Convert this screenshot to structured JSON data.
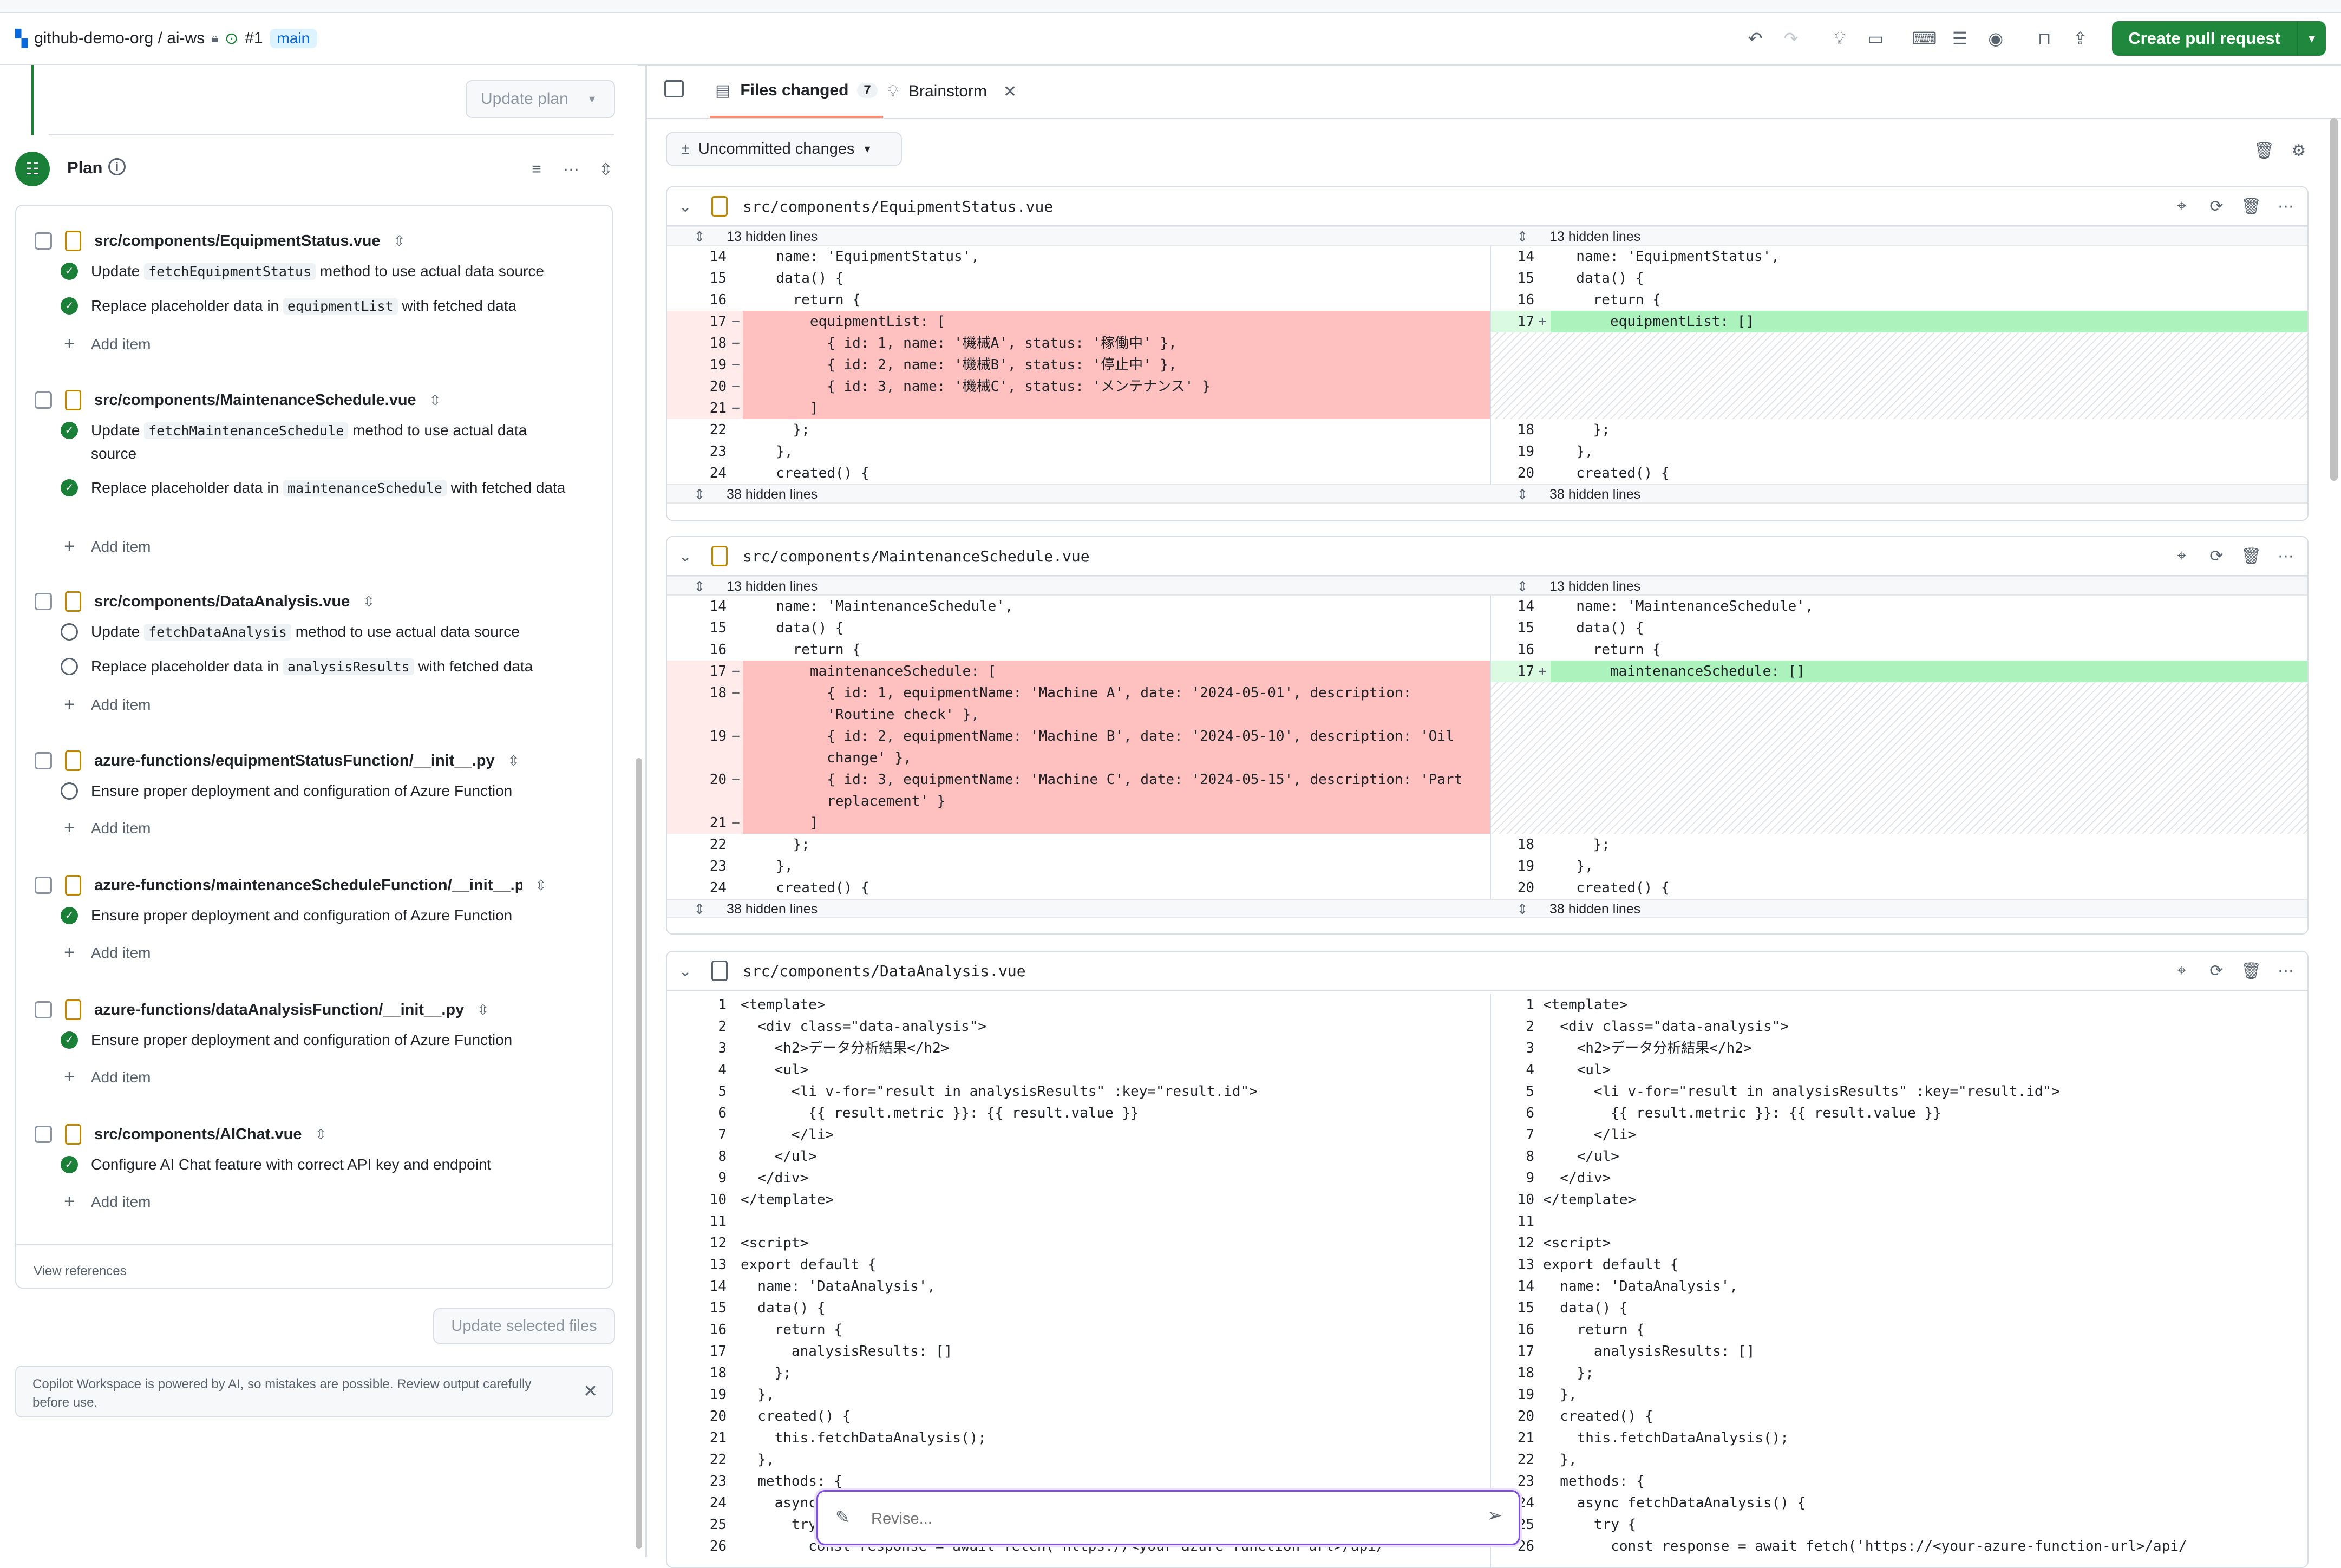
{
  "header": {
    "repo": "github-demo-org / ai-ws",
    "issue": "#1",
    "branch": "main",
    "create_pr": "Create pull request"
  },
  "plan": {
    "update_plan": "Update plan",
    "title": "Plan",
    "groups": [
      {
        "file": "src/components/EquipmentStatus.vue",
        "tasks": [
          {
            "status": "done",
            "pre": "Update ",
            "code": "fetchEquipmentStatus",
            "post": " method to use actual data source"
          },
          {
            "status": "done",
            "pre": "Replace placeholder data in ",
            "code": "equipmentList",
            "post": " with fetched data"
          }
        ]
      },
      {
        "file": "src/components/MaintenanceSchedule.vue",
        "tasks": [
          {
            "status": "done",
            "pre": "Update ",
            "code": "fetchMaintenanceSchedule",
            "post": " method to use actual data source"
          },
          {
            "status": "done",
            "pre": "Replace placeholder data in ",
            "code": "maintenanceSchedule",
            "post": " with fetched data"
          }
        ]
      },
      {
        "file": "src/components/DataAnalysis.vue",
        "tasks": [
          {
            "status": "open",
            "pre": "Update ",
            "code": "fetchDataAnalysis",
            "post": " method to use actual data source"
          },
          {
            "status": "open",
            "pre": "Replace placeholder data in ",
            "code": "analysisResults",
            "post": " with fetched data"
          }
        ]
      },
      {
        "file": "azure-functions/equipmentStatusFunction/__init__.py",
        "tasks": [
          {
            "status": "open",
            "pre": "Ensure proper deployment and configuration of Azure Function",
            "code": "",
            "post": ""
          }
        ]
      },
      {
        "file": "azure-functions/maintenanceScheduleFunction/__init__.py",
        "tasks": [
          {
            "status": "done",
            "pre": "Ensure proper deployment and configuration of Azure Function",
            "code": "",
            "post": ""
          }
        ]
      },
      {
        "file": "azure-functions/dataAnalysisFunction/__init__.py",
        "tasks": [
          {
            "status": "done",
            "pre": "Ensure proper deployment and configuration of Azure Function",
            "code": "",
            "post": ""
          }
        ]
      },
      {
        "file": "src/components/AIChat.vue",
        "tasks": [
          {
            "status": "done",
            "pre": "Configure AI Chat feature with correct API key and endpoint",
            "code": "",
            "post": ""
          }
        ]
      }
    ],
    "add_item": "Add item",
    "view_references": "View references",
    "update_selected": "Update selected files",
    "disclaimer": "Copilot Workspace is powered by AI, so mistakes are possible. Review output carefully before use."
  },
  "tabs": {
    "files_changed": "Files changed",
    "files_count": "7",
    "brainstorm": "Brainstorm"
  },
  "uncommitted": "Uncommitted changes",
  "diffs": [
    {
      "path": "src/components/EquipmentStatus.vue",
      "hidden_top": "13 hidden lines",
      "hidden_bottom": "38 hidden lines",
      "left": [
        {
          "n": "14",
          "m": "",
          "t": "  name: 'EquipmentStatus',"
        },
        {
          "n": "15",
          "m": "",
          "t": "  data() {"
        },
        {
          "n": "16",
          "m": "",
          "t": "    return {"
        },
        {
          "n": "17",
          "m": "−",
          "t": "      equipmentList: ["
        },
        {
          "n": "18",
          "m": "−",
          "t": "        { id: 1, name: '機械A', status: '稼働中' },"
        },
        {
          "n": "19",
          "m": "−",
          "t": "        { id: 2, name: '機械B', status: '停止中' },"
        },
        {
          "n": "20",
          "m": "−",
          "t": "        { id: 3, name: '機械C', status: 'メンテナンス' }"
        },
        {
          "n": "21",
          "m": "−",
          "t": "      ]"
        },
        {
          "n": "22",
          "m": "",
          "t": "    };"
        },
        {
          "n": "23",
          "m": "",
          "t": "  },"
        },
        {
          "n": "24",
          "m": "",
          "t": "  created() {"
        }
      ],
      "right": [
        {
          "n": "14",
          "m": "",
          "t": "  name: 'EquipmentStatus',"
        },
        {
          "n": "15",
          "m": "",
          "t": "  data() {"
        },
        {
          "n": "16",
          "m": "",
          "t": "    return {"
        },
        {
          "n": "17",
          "m": "+",
          "t": "      equipmentList: []"
        },
        {
          "n": "18",
          "m": "",
          "t": "    };"
        },
        {
          "n": "19",
          "m": "",
          "t": "  },"
        },
        {
          "n": "20",
          "m": "",
          "t": "  created() {"
        }
      ]
    },
    {
      "path": "src/components/MaintenanceSchedule.vue",
      "hidden_top": "13 hidden lines",
      "hidden_bottom": "38 hidden lines",
      "left": [
        {
          "n": "14",
          "m": "",
          "t": "  name: 'MaintenanceSchedule',"
        },
        {
          "n": "15",
          "m": "",
          "t": "  data() {"
        },
        {
          "n": "16",
          "m": "",
          "t": "    return {"
        },
        {
          "n": "17",
          "m": "−",
          "t": "      maintenanceSchedule: ["
        },
        {
          "n": "18",
          "m": "−",
          "t": "        { id: 1, equipmentName: 'Machine A', date: '2024-05-01', description:\n        'Routine check' },"
        },
        {
          "n": "19",
          "m": "−",
          "t": "        { id: 2, equipmentName: 'Machine B', date: '2024-05-10', description: 'Oil\n        change' },"
        },
        {
          "n": "20",
          "m": "−",
          "t": "        { id: 3, equipmentName: 'Machine C', date: '2024-05-15', description: 'Part\n        replacement' }"
        },
        {
          "n": "21",
          "m": "−",
          "t": "      ]"
        },
        {
          "n": "22",
          "m": "",
          "t": "    };"
        },
        {
          "n": "23",
          "m": "",
          "t": "  },"
        },
        {
          "n": "24",
          "m": "",
          "t": "  created() {"
        }
      ],
      "right": [
        {
          "n": "14",
          "m": "",
          "t": "  name: 'MaintenanceSchedule',"
        },
        {
          "n": "15",
          "m": "",
          "t": "  data() {"
        },
        {
          "n": "16",
          "m": "",
          "t": "    return {"
        },
        {
          "n": "17",
          "m": "+",
          "t": "      maintenanceSchedule: []"
        },
        {
          "n": "18",
          "m": "",
          "t": "    };"
        },
        {
          "n": "19",
          "m": "",
          "t": "  },"
        },
        {
          "n": "20",
          "m": "",
          "t": "  created() {"
        }
      ]
    },
    {
      "path": "src/components/DataAnalysis.vue",
      "lines": [
        "<template>",
        "  <div class=\"data-analysis\">",
        "    <h2>データ分析結果</h2>",
        "    <ul>",
        "      <li v-for=\"result in analysisResults\" :key=\"result.id\">",
        "        {{ result.metric }}: {{ result.value }}",
        "      </li>",
        "    </ul>",
        "  </div>",
        "</template>",
        "",
        "<script>",
        "export default {",
        "  name: 'DataAnalysis',",
        "  data() {",
        "    return {",
        "      analysisResults: []",
        "    };",
        "  },",
        "  created() {",
        "    this.fetchDataAnalysis();",
        "  },",
        "  methods: {",
        "    async fetchDataAnalysis() {",
        "      try {",
        "        const response = await fetch('https://<your-azure-function-url>/api/"
      ]
    }
  ],
  "revise_placeholder": "Revise..."
}
